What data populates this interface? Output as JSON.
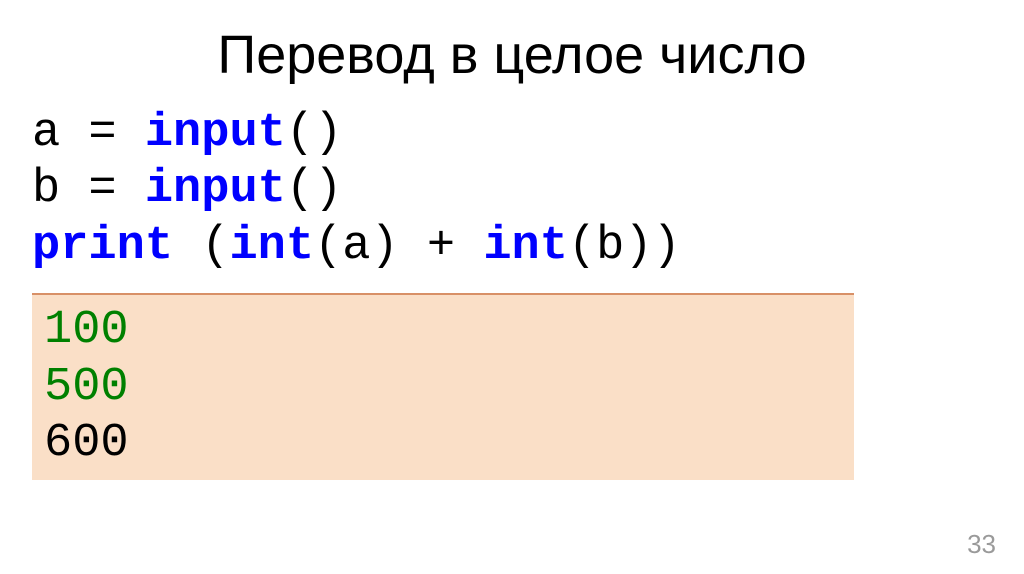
{
  "title": "Перевод в целое число",
  "code": {
    "line1": {
      "var": "a = ",
      "func": "input",
      "parens": "()"
    },
    "line2": {
      "var": "b = ",
      "func": "input",
      "parens": "()"
    },
    "line3": {
      "print": "print",
      "space": " (",
      "int1": "int",
      "arg1": "(a) + ",
      "int2": "int",
      "arg2": "(b))"
    }
  },
  "output": {
    "line1": "100",
    "line2": "500",
    "line3": "600"
  },
  "page_number": "33"
}
